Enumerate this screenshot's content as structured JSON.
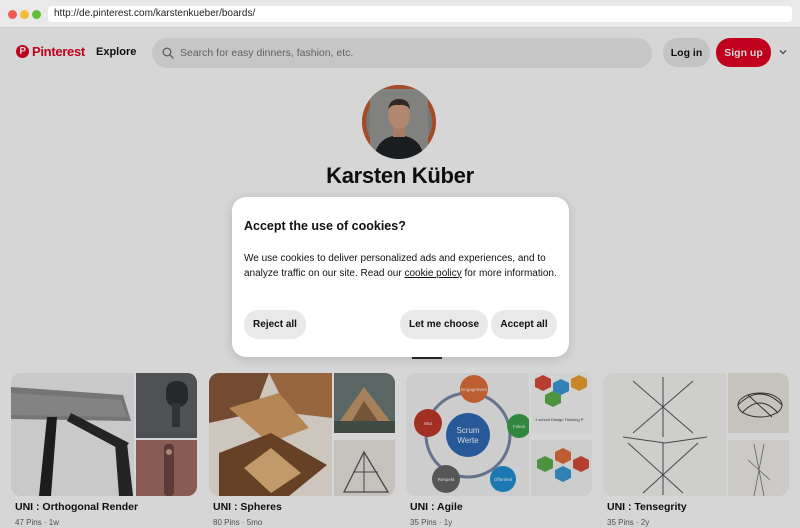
{
  "browser": {
    "url": "http://de.pinterest.com/karstenkueber/boards/"
  },
  "header": {
    "logo_text": "Pinterest",
    "explore_label": "Explore",
    "search_placeholder": "Search for easy dinners, fashion, etc.",
    "login_label": "Log in",
    "signup_label": "Sign up"
  },
  "profile": {
    "name": "Karsten Küber"
  },
  "boards": [
    {
      "title": "UNI : Orthogonal Render",
      "meta": "47 Pins · 1w"
    },
    {
      "title": "UNI : Spheres",
      "meta": "80 Pins · 5mo"
    },
    {
      "title": "UNI : Agile",
      "meta": "35 Pins · 1y"
    },
    {
      "title": "UNI : Tensegrity",
      "meta": "35 Pins · 2y"
    }
  ],
  "agile_thumb": {
    "center": [
      "Scrum",
      "Werte"
    ],
    "nodes": [
      "Engagement",
      "Fokus",
      "Offenheit",
      "Respekt",
      "Mut"
    ],
    "side_caption": "1 school Design Thinking P"
  },
  "cookie_modal": {
    "title": "Accept the use of cookies?",
    "body_before": "We use cookies to deliver personalized ads and experiences, and to analyze traffic on our site. Read our ",
    "link_text": "cookie policy",
    "body_after": " for more information.",
    "reject_label": "Reject all",
    "let_me_choose_label": "Let me choose",
    "accept_label": "Accept all"
  },
  "colors": {
    "brand": "#e60023",
    "button_gray": "#e9e9e9",
    "overlay": "rgba(0,0,0,0.16)"
  },
  "icons": [
    "pinterest-logo-icon",
    "search-icon",
    "chevron-down-icon"
  ]
}
